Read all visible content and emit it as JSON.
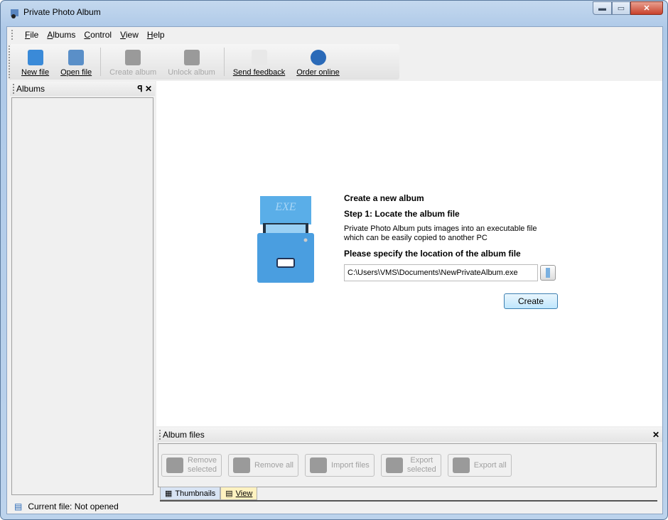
{
  "window": {
    "title": "Private Photo Album"
  },
  "menu": [
    {
      "key": "F",
      "rest": "ile"
    },
    {
      "key": "A",
      "rest": "lbums"
    },
    {
      "key": "C",
      "rest": "ontrol"
    },
    {
      "key": "V",
      "rest": "iew"
    },
    {
      "key": "H",
      "rest": "elp"
    }
  ],
  "toolbar": [
    {
      "label": "New file",
      "enabled": true,
      "icon": "new-file-icon",
      "color": "#3a8ad8"
    },
    {
      "label": "Open file",
      "enabled": true,
      "icon": "open-file-icon",
      "color": "#5a8fc8"
    },
    {
      "label": "Create album",
      "enabled": false,
      "icon": "create-album-icon",
      "color": "#9a9a9a"
    },
    {
      "label": "Unlock album",
      "enabled": false,
      "icon": "unlock-icon",
      "color": "#9a9a9a"
    },
    {
      "label": "Send feedback",
      "enabled": true,
      "icon": "envelope-icon",
      "color": "#e8e8e8"
    },
    {
      "label": "Order online",
      "enabled": true,
      "icon": "globe-icon",
      "color": "#2a6ab8"
    }
  ],
  "albums_panel": {
    "title": "Albums",
    "pin": "ꟼ",
    "close": "✕"
  },
  "wizard": {
    "heading": "Create a new album",
    "step": "Step 1: Locate the album file",
    "desc1": "Private Photo Album puts images into an executable file",
    "desc2": "which can be easily copied to another PC",
    "prompt": "Please specify the location of the album file",
    "path": "C:\\Users\\VMS\\Documents\\NewPrivateAlbum.exe",
    "create": "Create",
    "cabinet_label": "EXE"
  },
  "files_panel": {
    "title": "Album files",
    "close": "✕",
    "buttons": [
      {
        "l1": "Remove",
        "l2": "selected",
        "icon": "remove-selected-icon"
      },
      {
        "l1": "Remove all",
        "l2": "",
        "icon": "remove-all-icon"
      },
      {
        "l1": "Import files",
        "l2": "",
        "icon": "import-icon"
      },
      {
        "l1": "Export",
        "l2": "selected",
        "icon": "export-selected-icon"
      },
      {
        "l1": "Export all",
        "l2": "",
        "icon": "export-all-icon"
      }
    ],
    "tabs": [
      {
        "label": "Thumbnails"
      },
      {
        "label": "View"
      }
    ]
  },
  "status": {
    "text": "Current file: Not opened"
  }
}
